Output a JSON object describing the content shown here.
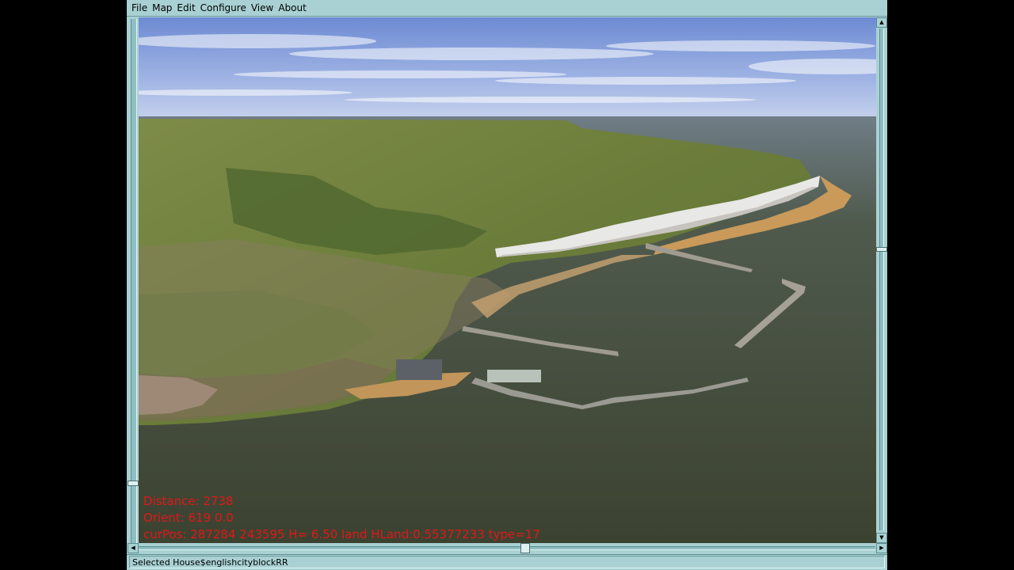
{
  "menubar": {
    "items": [
      {
        "label": "File"
      },
      {
        "label": "Map"
      },
      {
        "label": "Edit"
      },
      {
        "label": "Configure"
      },
      {
        "label": "View"
      },
      {
        "label": "About"
      }
    ]
  },
  "hud": {
    "distance": "Distance: 2738",
    "orient": "Orient: 619 0.0",
    "curpos": "curPos: 287284 243595 H= 6.50 land HLand:0.55377233 type=17"
  },
  "statusbar": {
    "text": "Selected House$englishcityblockRR"
  },
  "scrollbars": {
    "up_arrow": "▲",
    "down_arrow": "▼",
    "left_arrow": "◀",
    "right_arrow": "▶"
  },
  "colors": {
    "chrome": "#a9d1d3",
    "hud_text": "#e01818",
    "sea": "#3f4532",
    "sky": "#8da4dd",
    "land": "#6e7f3a",
    "cliff": "#e6e6e6",
    "beach": "#c99a5a"
  }
}
